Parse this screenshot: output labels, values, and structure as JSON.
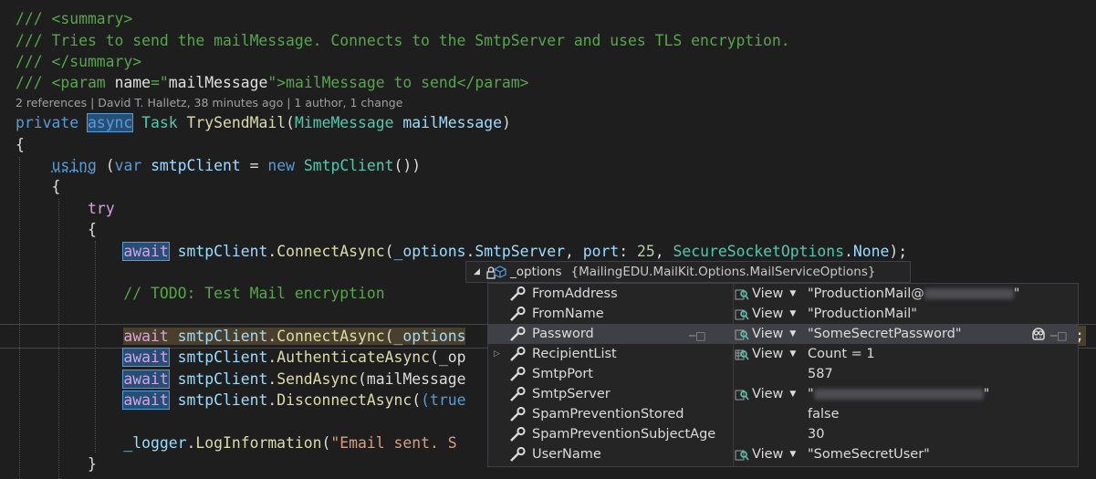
{
  "code": {
    "l1": "/// <summary>",
    "l2": "/// Tries to send the mailMessage. Connects to the SmtpServer and uses TLS encryption.",
    "l3": "/// </summary>",
    "l4a": "/// <param ",
    "l4b": "name",
    "l4c": "=\"",
    "l4d": "mailMessage",
    "l4e": "\">mailMessage to send</param>",
    "codelens": "2 references | David T. Halletz, 38 minutes ago | 1 author, 1 change",
    "sig_private": "private",
    "sig_async": "async",
    "sig_task": "Task",
    "sig_method": "TrySendMail",
    "sig_type": "MimeMessage",
    "sig_param": "mailMessage",
    "using_kw": "using",
    "var_kw": "var",
    "smtp_var": "smtpClient",
    "new_kw": "new",
    "smtp_type": "SmtpClient",
    "try_kw": "try",
    "await": "await",
    "connect": "ConnectAsync",
    "options": "_options",
    "smtpserver": "SmtpServer",
    "port": "port",
    "port_num": "25",
    "secure_type": "SecureSocketOptions",
    "none": "None",
    "todo": "// TODO: Test Mail encryption",
    "cur_line_rest": "_options",
    "auth": "AuthenticateAsync",
    "auth_rest": "(_op",
    "send": "SendAsync",
    "send_rest": "(mailMessage",
    "disconnect": "DisconnectAsync",
    "disc_rest": "(true",
    "logger": "_logger",
    "loginfo": "LogInformation",
    "log_str": "\"Email sent. S"
  },
  "datatip": {
    "name": "_options",
    "type_name": "{MailingEDU.MailKit.Options.MailServiceOptions}",
    "view_label": "View",
    "rows": [
      {
        "name": "FromAddress",
        "value_prefix": "\"ProductionMail@",
        "value_suffix": "\"",
        "has_view": true
      },
      {
        "name": "FromName",
        "value": "\"ProductionMail\"",
        "has_view": true
      },
      {
        "name": "Password",
        "value": "\"SomeSecretPassword\"",
        "has_view": true
      },
      {
        "name": "RecipientList",
        "value": "Count = 1",
        "has_view": true
      },
      {
        "name": "SmtpPort",
        "value": "587",
        "has_view": false
      },
      {
        "name": "SmtpServer",
        "value_prefix": "\"",
        "value_suffix": "\"",
        "has_view": true
      },
      {
        "name": "SpamPreventionStored",
        "value": "false",
        "has_view": false
      },
      {
        "name": "SpamPreventionSubjectAge",
        "value": "30",
        "has_view": false
      },
      {
        "name": "UserName",
        "value": "\"SomeSecretUser\"",
        "has_view": true
      }
    ]
  },
  "colors": {
    "background": "#1e1e1e",
    "comment": "#57a64a",
    "keyword": "#569cd6",
    "control": "#d8a0df",
    "type": "#4ec9b0",
    "method": "#dcdcaa",
    "string": "#d69d85"
  }
}
